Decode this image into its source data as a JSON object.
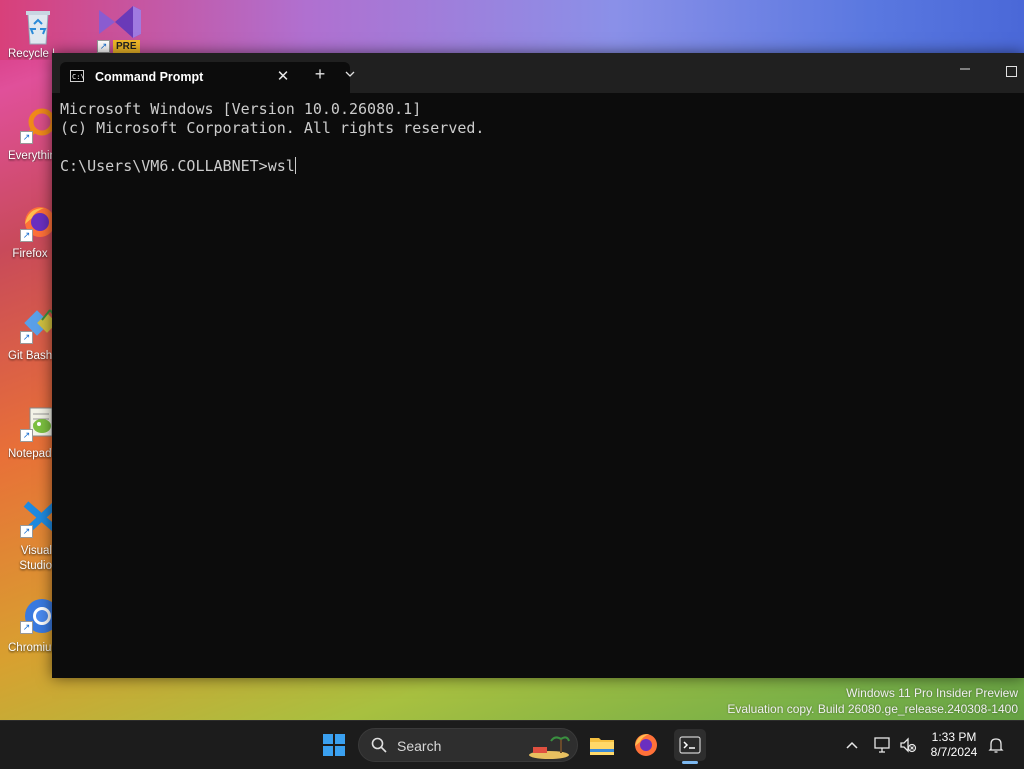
{
  "desktop": {
    "icons": [
      {
        "label": "Recycle Bin",
        "icon": "recycle-bin-icon"
      },
      {
        "label": "PRE",
        "icon": "visual-studio-preview-icon"
      },
      {
        "label": "Everything",
        "icon": "everything-search-icon"
      },
      {
        "label": "Firefox",
        "icon": "firefox-icon"
      },
      {
        "label": "Git Bash",
        "icon": "git-bash-icon"
      },
      {
        "label": "Notepad++",
        "icon": "notepad-plus-plus-icon"
      },
      {
        "label": "Visual Studio Code",
        "icon": "vscode-icon"
      },
      {
        "label": "Chromium",
        "icon": "chromium-icon"
      }
    ],
    "watermark": {
      "line1": "Windows 11 Pro Insider Preview",
      "line2": "Evaluation copy. Build 26080.ge_release.240308-1400"
    }
  },
  "terminal": {
    "tab_title": "Command Prompt",
    "tab_icon_text": "C:\\",
    "new_tab_label": "+",
    "dropdown_label": "⌄",
    "close_label": "✕",
    "minimize_label": "—",
    "lines": [
      "Microsoft Windows [Version 10.0.26080.1]",
      "(c) Microsoft Corporation. All rights reserved.",
      "",
      "C:\\Users\\VM6.COLLABNET>wsl"
    ]
  },
  "taskbar": {
    "search_placeholder": "Search",
    "pinned": [
      "start-icon",
      "file-explorer-icon",
      "firefox-icon",
      "terminal-icon"
    ],
    "clock_time": "1:33 PM",
    "clock_date": "8/7/2024",
    "tray_chevron": "^"
  },
  "colors": {
    "console_bg": "#0c0c0c",
    "console_fg": "#cccccc",
    "titlebar_bg": "#202020",
    "taskbar_bg": "#1c1c1c",
    "accent": "#7cb8f0"
  }
}
